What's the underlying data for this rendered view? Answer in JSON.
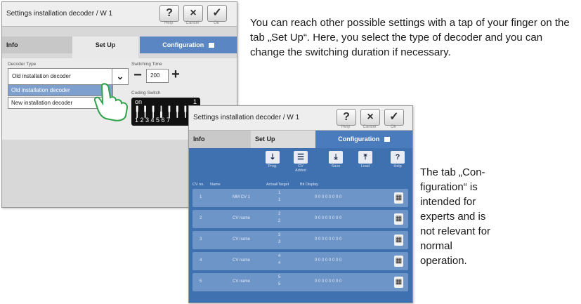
{
  "win1": {
    "title": "Settings installation decoder / W 1",
    "help": "?",
    "help_caption": "Help",
    "cancel": "×",
    "cancel_caption": "Cancel",
    "ok": "✓",
    "ok_caption": "Ok",
    "tabs": [
      "Info",
      "Set Up",
      "Configuration"
    ],
    "decoder_type_label": "Decoder Type",
    "decoder_type_value": "Old installation decoder",
    "options": [
      "Old installation decoder",
      "New installation decoder"
    ],
    "switching_time_label": "Switching Time",
    "switching_minus": "−",
    "switching_value": "200",
    "switching_plus": "+",
    "coding_switch_label": "Coding Switch",
    "coding_on": "on",
    "coding_one": "1",
    "coding_numbers": "1 2 3 4 5 6 7"
  },
  "win2": {
    "title": "Settings installation decoder / W 1",
    "help": "?",
    "help_caption": "Help",
    "cancel": "×",
    "cancel_caption": "Cancel",
    "ok": "✓",
    "ok_caption": "Ok",
    "tabs": [
      "Info",
      "Set Up",
      "Configuration"
    ],
    "tools": [
      {
        "icon": "⇣",
        "label": "Prog."
      },
      {
        "icon": "☰",
        "label": "CV Added"
      },
      {
        "icon": "⤓",
        "label": "Save"
      },
      {
        "icon": "⤒",
        "label": "Load"
      },
      {
        "icon": "?",
        "label": "Help"
      }
    ],
    "columns": [
      "CV no.",
      "Name",
      "Actual/Target",
      "Bit Display"
    ],
    "rows": [
      {
        "no": "1",
        "name": "MM CV 1",
        "actual": "1",
        "target": "1",
        "bits": "0 0 0 0 0 0 0 0"
      },
      {
        "no": "2",
        "name": "CV name",
        "actual": "2",
        "target": "2",
        "bits": "0 0 0 0 0 0 0 0"
      },
      {
        "no": "3",
        "name": "CV name",
        "actual": "3",
        "target": "3",
        "bits": "0 0 0 0 0 0 0 0"
      },
      {
        "no": "4",
        "name": "CV name",
        "actual": "4",
        "target": "4",
        "bits": "0 0 0 0 0 0 0 0"
      },
      {
        "no": "5",
        "name": "CV name",
        "actual": "5",
        "target": "5",
        "bits": "0 0 0 0 0 0 0 0"
      }
    ]
  },
  "text_top": "You can reach other possible settings with a tap of your finger on the tab „Set Up“. Here, you select the type of decoder and you can change the switching duration if necessary.",
  "text_right": "The tab „Con-figuration“ is intended for experts and is not relevant for normal operation."
}
